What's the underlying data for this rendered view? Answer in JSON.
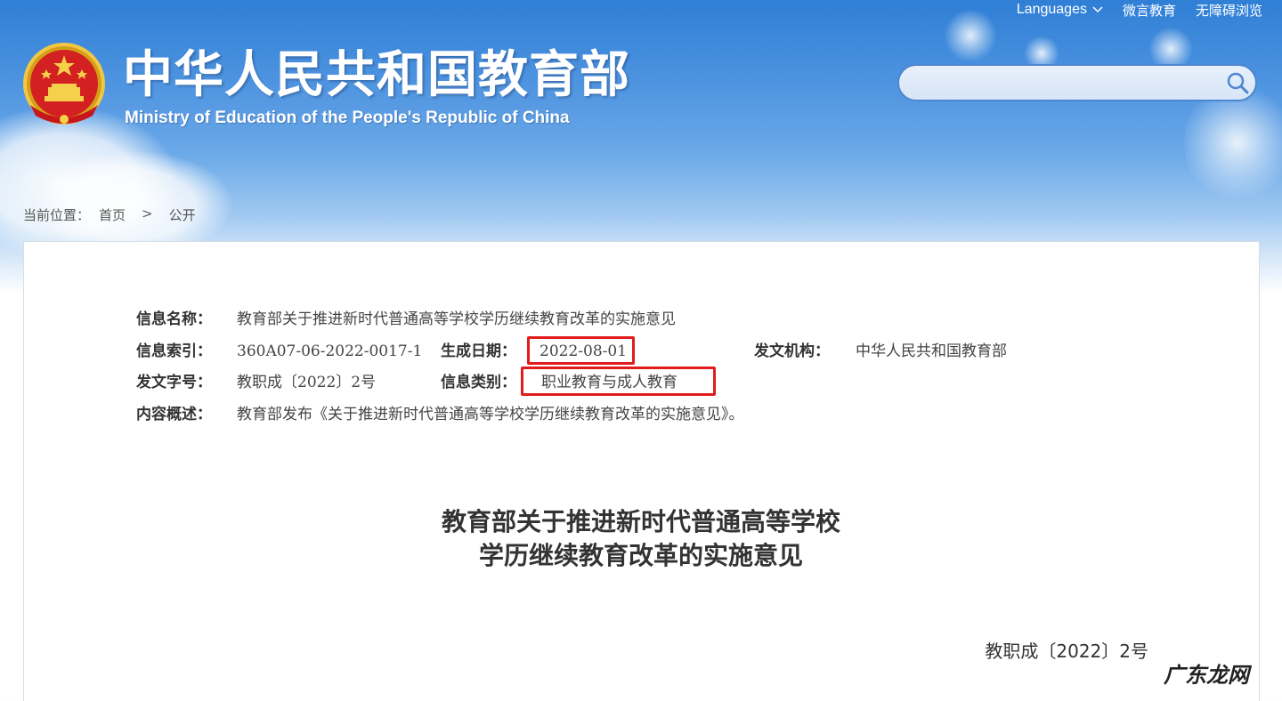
{
  "header": {
    "languages_label": "Languages",
    "weiyan_label": "微言教育",
    "accessibility_label": "无障碍浏览",
    "site_title": "中华人民共和国教育部",
    "site_subtitle": "Ministry of Education of the People's Republic of China",
    "search": {
      "placeholder": "",
      "value": ""
    }
  },
  "breadcrumb": {
    "prefix": "当前位置：",
    "items": [
      "首页",
      "公开"
    ],
    "separator": ">"
  },
  "meta": {
    "name_label": "信息名称：",
    "name_value": "教育部关于推进新时代普通高等学校学历继续教育改革的实施意见",
    "index_label": "信息索引：",
    "index_value": "360A07-06-2022-0017-1",
    "date_label": "生成日期：",
    "date_value": "2022-08-01",
    "issuer_label": "发文机构：",
    "issuer_value": "中华人民共和国教育部",
    "docno_label": "发文字号：",
    "docno_value": "教职成〔2022〕2号",
    "category_label": "信息类别：",
    "category_value": "职业教育与成人教育",
    "summary_label": "内容概述：",
    "summary_value": "教育部发布《关于推进新时代普通高等学校学历继续教育改革的实施意见》。"
  },
  "document": {
    "title_line1": "教育部关于推进新时代普通高等学校",
    "title_line2": "学历继续教育改革的实施意见",
    "number": "教职成〔2022〕2号"
  },
  "watermark": "广东龙网",
  "colors": {
    "highlight": "#e21b1b",
    "header_blue": "#2f7fd6",
    "search_border": "#4e86cf"
  }
}
